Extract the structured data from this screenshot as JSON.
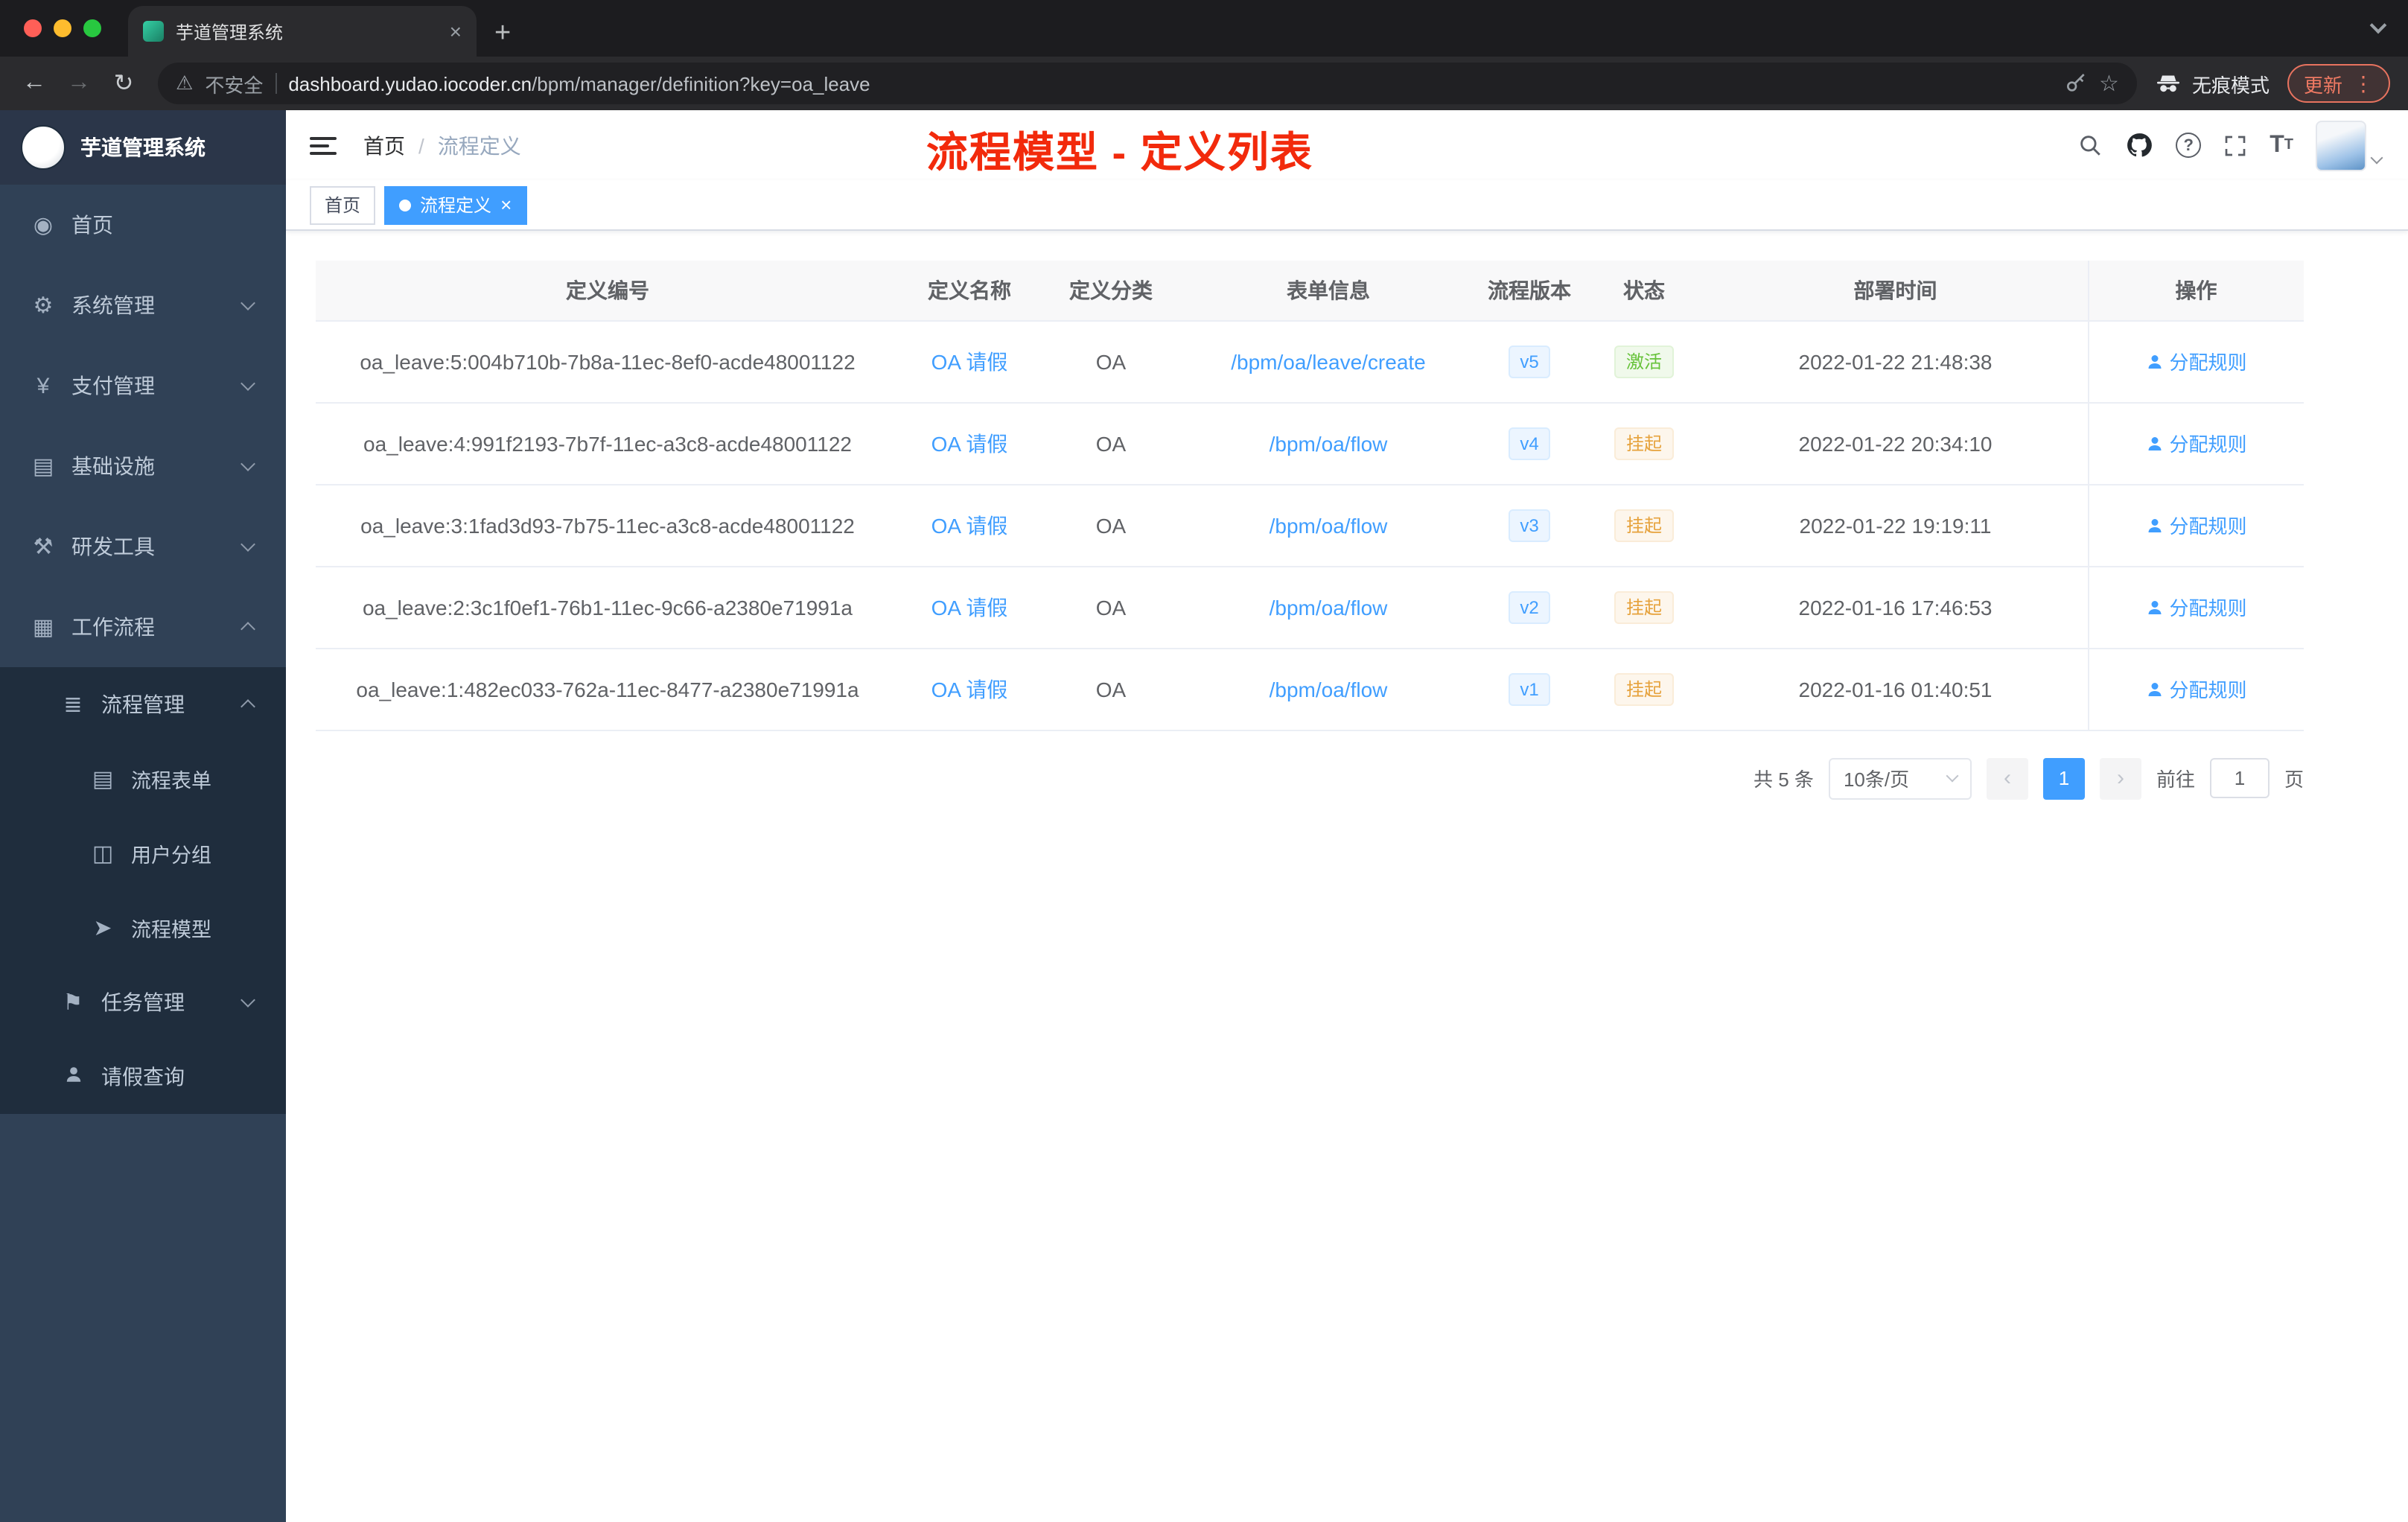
{
  "browser": {
    "tab_title": "芋道管理系统",
    "security_label": "不安全",
    "url_host": "dashboard.yudao.iocoder.cn",
    "url_path": "/bpm/manager/definition?key=oa_leave",
    "incognito_label": "无痕模式",
    "update_label": "更新"
  },
  "icons": {
    "back": "←",
    "forward": "→",
    "reload": "↻",
    "warning": "⚠",
    "star": "☆",
    "new_tab": "+",
    "tab_close": "×",
    "tag_close": "×",
    "menu_dots": "⋮"
  },
  "sidebar": {
    "logo_title": "芋道管理系统",
    "items": [
      {
        "label": "首页",
        "icon": "◉"
      },
      {
        "label": "系统管理",
        "icon": "⚙"
      },
      {
        "label": "支付管理",
        "icon": "¥"
      },
      {
        "label": "基础设施",
        "icon": "▤"
      },
      {
        "label": "研发工具",
        "icon": "⚒"
      },
      {
        "label": "工作流程",
        "icon": "▦"
      },
      {
        "label": "流程管理",
        "icon": "≣"
      },
      {
        "label": "流程表单",
        "icon": "▤"
      },
      {
        "label": "用户分组",
        "icon": "◫"
      },
      {
        "label": "流程模型",
        "icon": "➤"
      },
      {
        "label": "任务管理",
        "icon": "⚑"
      },
      {
        "label": "请假查询",
        "icon": "☻"
      }
    ]
  },
  "header": {
    "breadcrumb_home": "首页",
    "breadcrumb_separator": "/",
    "breadcrumb_current": "流程定义",
    "annotation": "流程模型 - 定义列表"
  },
  "tags": {
    "home": "首页",
    "active": "流程定义"
  },
  "table": {
    "columns": [
      "定义编号",
      "定义名称",
      "定义分类",
      "表单信息",
      "流程版本",
      "状态",
      "部署时间",
      "操作"
    ],
    "action_label": "分配规则",
    "rows": [
      {
        "id": "oa_leave:5:004b710b-7b8a-11ec-8ef0-acde48001122",
        "name": "OA 请假",
        "category": "OA",
        "form": "/bpm/oa/leave/create",
        "version": "v5",
        "status": "激活",
        "status_type": "active",
        "time": "2022-01-22 21:48:38"
      },
      {
        "id": "oa_leave:4:991f2193-7b7f-11ec-a3c8-acde48001122",
        "name": "OA 请假",
        "category": "OA",
        "form": "/bpm/oa/flow",
        "version": "v4",
        "status": "挂起",
        "status_type": "suspended",
        "time": "2022-01-22 20:34:10"
      },
      {
        "id": "oa_leave:3:1fad3d93-7b75-11ec-a3c8-acde48001122",
        "name": "OA 请假",
        "category": "OA",
        "form": "/bpm/oa/flow",
        "version": "v3",
        "status": "挂起",
        "status_type": "suspended",
        "time": "2022-01-22 19:19:11"
      },
      {
        "id": "oa_leave:2:3c1f0ef1-76b1-11ec-9c66-a2380e71991a",
        "name": "OA 请假",
        "category": "OA",
        "form": "/bpm/oa/flow",
        "version": "v2",
        "status": "挂起",
        "status_type": "suspended",
        "time": "2022-01-16 17:46:53"
      },
      {
        "id": "oa_leave:1:482ec033-762a-11ec-8477-a2380e71991a",
        "name": "OA 请假",
        "category": "OA",
        "form": "/bpm/oa/flow",
        "version": "v1",
        "status": "挂起",
        "status_type": "suspended",
        "time": "2022-01-16 01:40:51"
      }
    ]
  },
  "pagination": {
    "total": "共 5 条",
    "page_size": "10条/页",
    "prev": "‹",
    "current_page": "1",
    "next": "›",
    "goto_label": "前往",
    "goto_value": "1",
    "page_unit": "页"
  }
}
